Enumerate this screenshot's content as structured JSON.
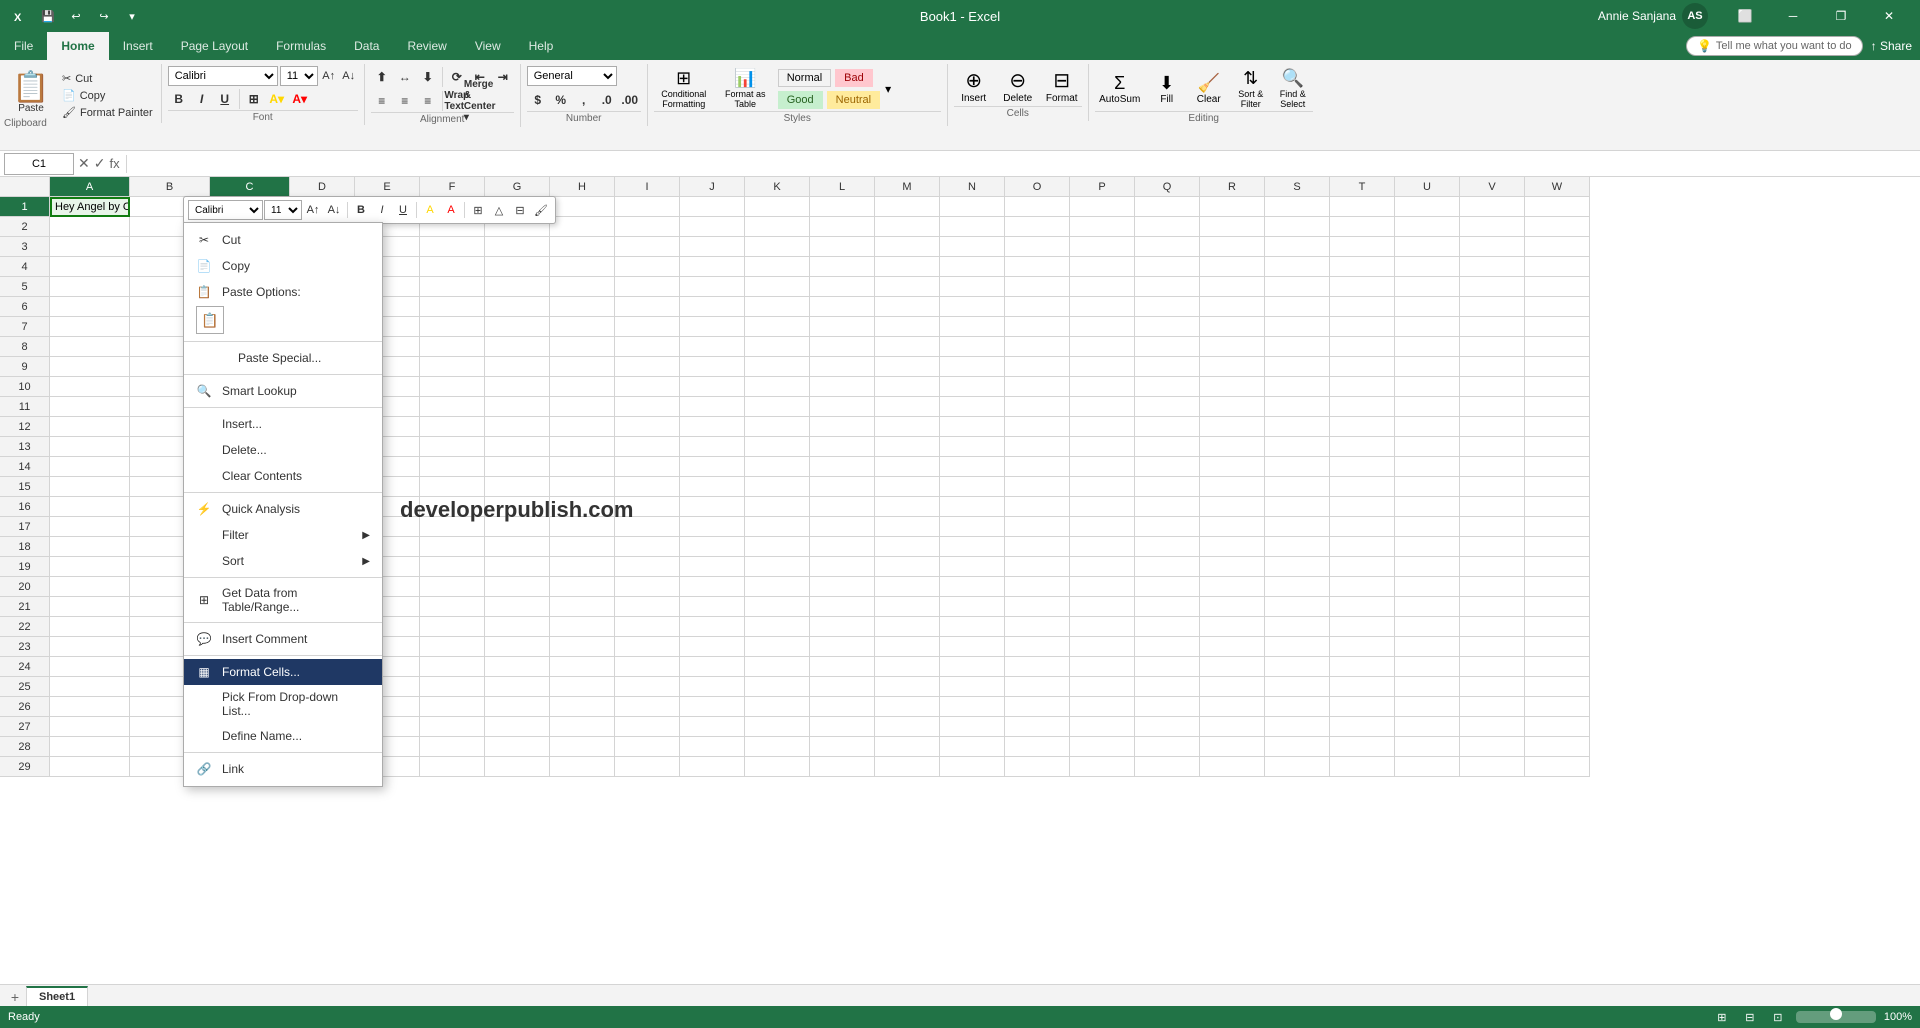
{
  "titleBar": {
    "title": "Book1 - Excel",
    "user": "Annie Sanjana",
    "userInitials": "AS",
    "controls": [
      "minimize",
      "restore",
      "close"
    ],
    "qat": [
      "save",
      "undo",
      "redo",
      "customize"
    ]
  },
  "ribbon": {
    "tabs": [
      "File",
      "Home",
      "Insert",
      "Page Layout",
      "Formulas",
      "Data",
      "Review",
      "View",
      "Help"
    ],
    "activeTab": "Home",
    "groups": {
      "clipboard": {
        "label": "Clipboard",
        "paste": "Paste",
        "cut": "Cut",
        "copy": "Copy",
        "formatPainter": "Format Painter"
      },
      "font": {
        "label": "Font",
        "fontName": "Calibri",
        "fontSize": "11"
      },
      "alignment": {
        "label": "Alignment",
        "wrapText": "Wrap Text",
        "mergeCenter": "Merge & Center"
      },
      "number": {
        "label": "Number",
        "format": "General"
      },
      "styles": {
        "label": "Styles",
        "conditionalFormatting": "Conditional Formatting",
        "formatAsTable": "Format as Table",
        "normal": "Normal",
        "bad": "Bad",
        "good": "Good",
        "neutral": "Neutral"
      },
      "cells": {
        "label": "Cells",
        "insert": "Insert",
        "delete": "Delete",
        "format": "Format"
      },
      "editing": {
        "label": "Editing",
        "autoSum": "AutoSum",
        "fill": "Fill",
        "clear": "Clear",
        "sortFilter": "Sort & Filter",
        "findSelect": "Find & Select"
      }
    }
  },
  "formulaBar": {
    "cellRef": "C1",
    "formula": ""
  },
  "miniToolbar": {
    "fontName": "Calibri",
    "fontSize": "11"
  },
  "contextMenu": {
    "items": [
      {
        "id": "cut",
        "label": "Cut",
        "icon": "✂",
        "hasIcon": true
      },
      {
        "id": "copy",
        "label": "Copy",
        "icon": "📋",
        "hasIcon": true
      },
      {
        "id": "paste-options",
        "label": "Paste Options:",
        "icon": "📄",
        "hasIcon": true,
        "isPasteOptions": true
      },
      {
        "id": "paste-special",
        "label": "Paste Special...",
        "icon": "",
        "hasIcon": false,
        "isIndented": true
      },
      {
        "id": "smart-lookup",
        "label": "Smart Lookup",
        "icon": "🔍",
        "hasIcon": true
      },
      {
        "id": "insert",
        "label": "Insert...",
        "icon": "",
        "hasIcon": false
      },
      {
        "id": "delete",
        "label": "Delete...",
        "icon": "",
        "hasIcon": false
      },
      {
        "id": "clear-contents",
        "label": "Clear Contents",
        "icon": "",
        "hasIcon": false
      },
      {
        "id": "quick-analysis",
        "label": "Quick Analysis",
        "icon": "⚡",
        "hasIcon": true
      },
      {
        "id": "filter",
        "label": "Filter",
        "icon": "",
        "hasIcon": false,
        "hasSubmenu": true
      },
      {
        "id": "sort",
        "label": "Sort",
        "icon": "",
        "hasIcon": false,
        "hasSubmenu": true
      },
      {
        "id": "get-data",
        "label": "Get Data from Table/Range...",
        "icon": "⊞",
        "hasIcon": true
      },
      {
        "id": "insert-comment",
        "label": "Insert Comment",
        "icon": "💬",
        "hasIcon": true
      },
      {
        "id": "format-cells",
        "label": "Format Cells...",
        "icon": "▦",
        "hasIcon": true,
        "isActive": true
      },
      {
        "id": "pick-dropdown",
        "label": "Pick From Drop-down List...",
        "icon": "",
        "hasIcon": false
      },
      {
        "id": "define-name",
        "label": "Define Name...",
        "icon": "",
        "hasIcon": false
      },
      {
        "id": "link",
        "label": "Link",
        "icon": "🔗",
        "hasIcon": true
      }
    ]
  },
  "spreadsheet": {
    "cellRef": "C1",
    "cell1Content": "Hey Angel by One Direction",
    "watermark": "developerpublish.com",
    "columns": [
      "A",
      "B",
      "C",
      "D",
      "E",
      "F",
      "G",
      "H",
      "I",
      "J",
      "K",
      "L",
      "M",
      "N",
      "O",
      "P",
      "Q",
      "R",
      "S",
      "T",
      "U",
      "V",
      "W"
    ],
    "rows": 29
  },
  "statusBar": {
    "status": "Ready",
    "viewNormal": "⊞",
    "viewPageLayout": "⊟",
    "viewPageBreak": "⊡",
    "zoom": "100%"
  },
  "sheetTabs": [
    {
      "name": "Sheet1",
      "active": true
    }
  ]
}
